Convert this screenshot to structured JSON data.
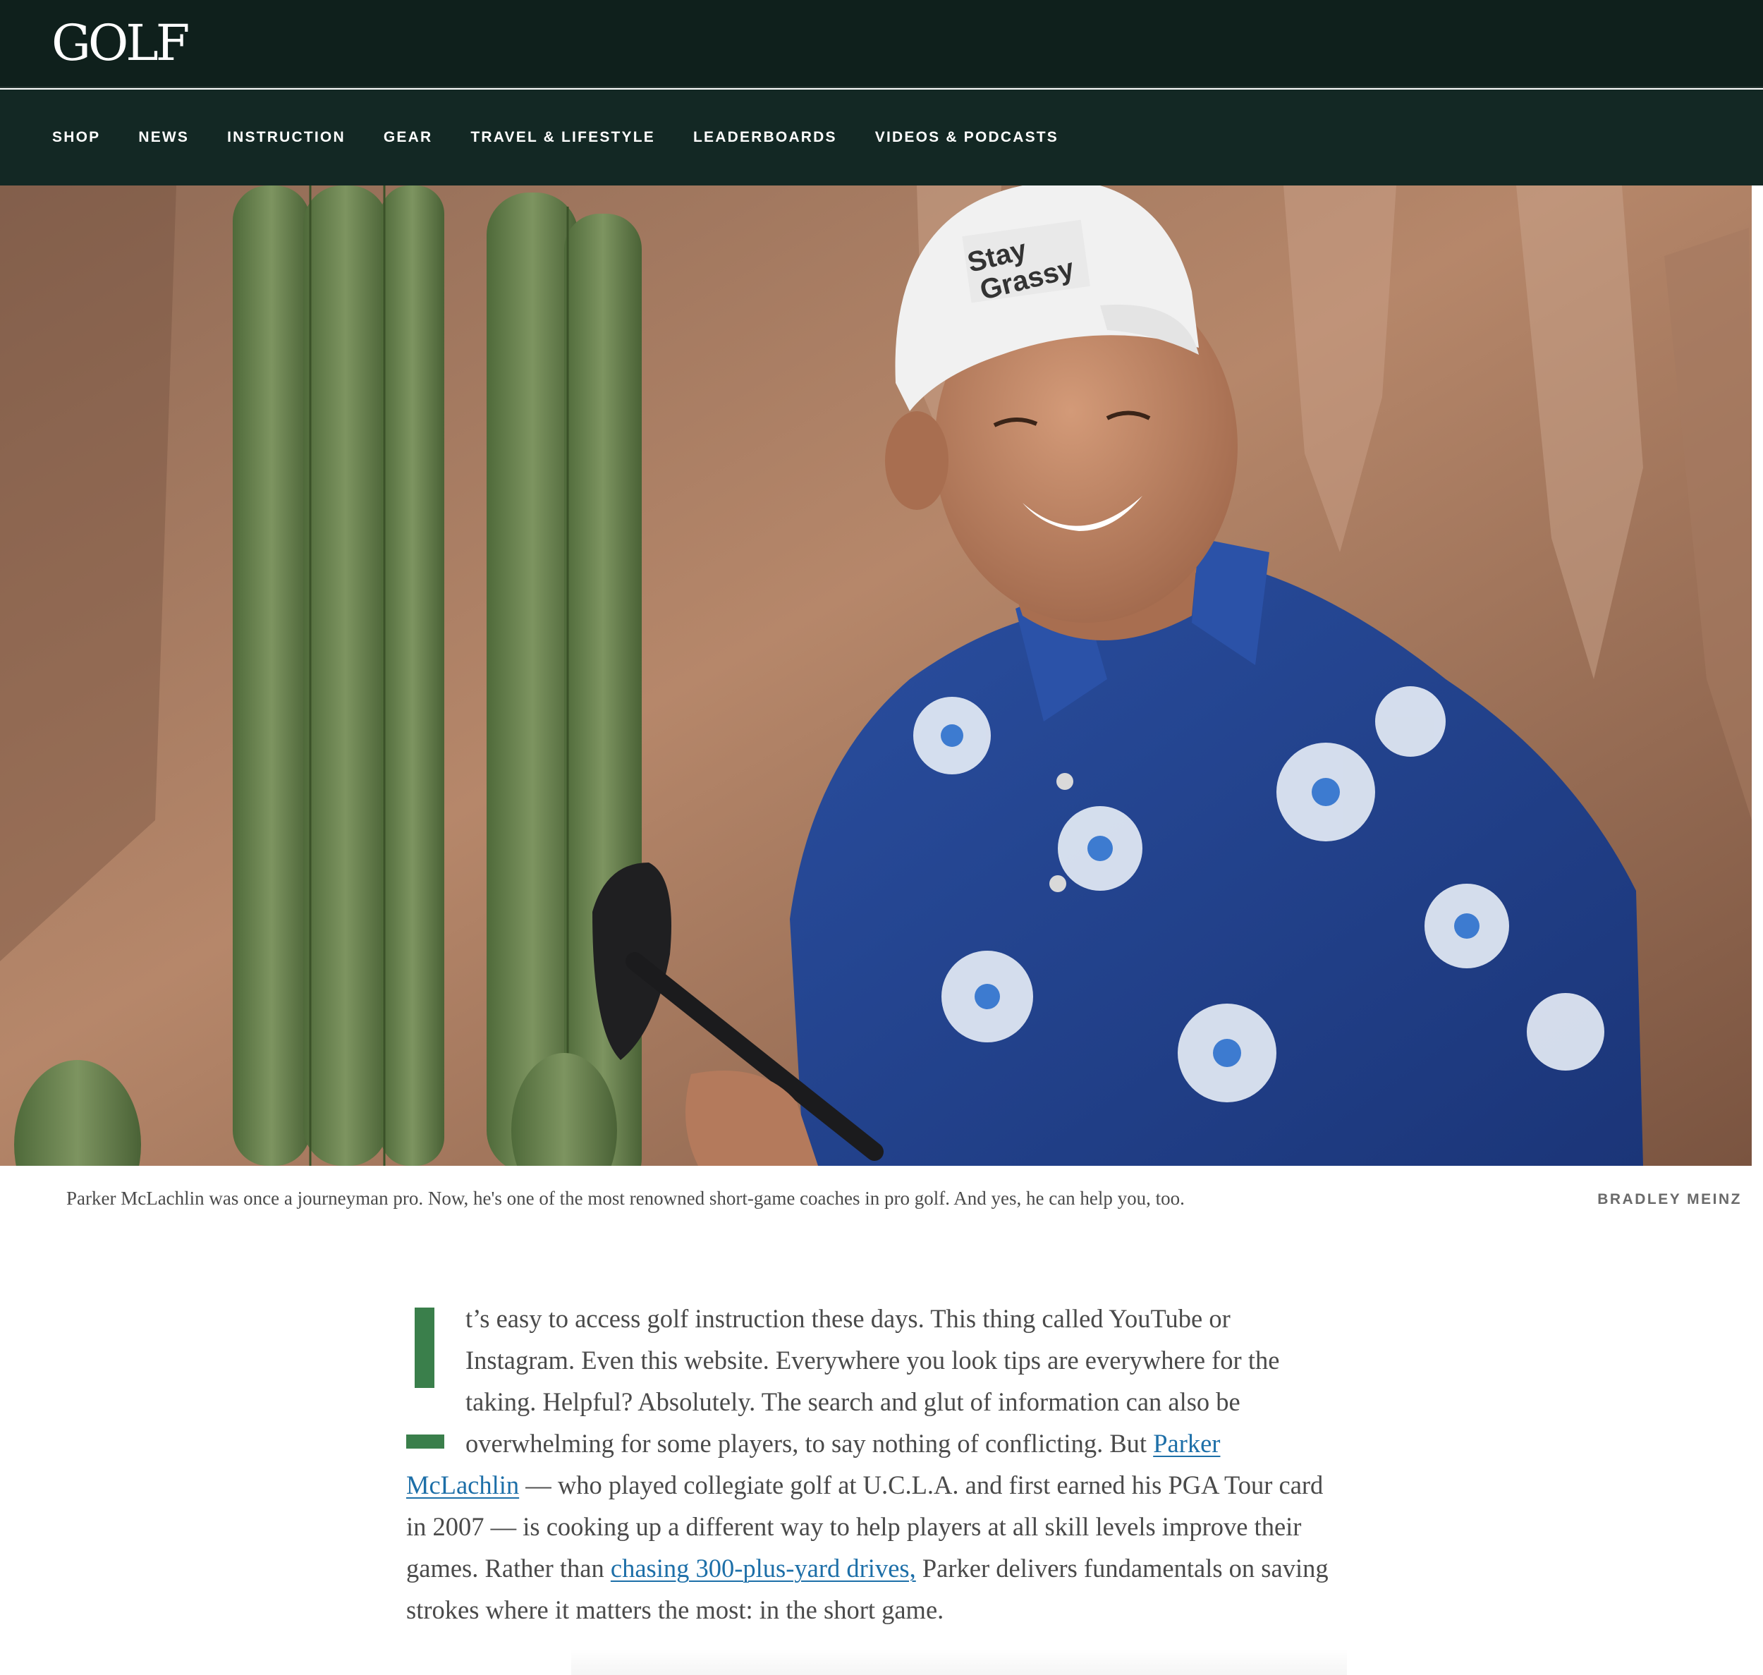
{
  "header": {
    "logo": "GOLF",
    "nav": [
      "SHOP",
      "NEWS",
      "INSTRUCTION",
      "GEAR",
      "TRAVEL & LIFESTYLE",
      "LEADERBOARDS",
      "VIDEOS & PODCASTS"
    ]
  },
  "hero": {
    "hat_text_line1": "Stay",
    "hat_text_line2": "Grassy"
  },
  "caption": {
    "text": "Parker McLachlin was once a journeyman pro. Now, he's one of the most renowned short-game coaches in pro golf. And yes, he can help you, too.",
    "credit": "BRADLEY MEINZ"
  },
  "article": {
    "dropcap": "I",
    "p1": "t’s easy to access golf instruction these days. This thing called YouTube or Instagram. Even this website. Everywhere you look tips are everywhere for the taking. Helpful? Absolutely. The search and glut of information can also be overwhelming for some players, to say nothing of conflicting. But ",
    "link1": "Parker McLachlin",
    "p2": " — who played collegiate golf at U.C.L.A. and first earned his PGA Tour card in 2007 —  is cooking up a different way to help players at all skill levels improve their games. Rather than ",
    "link2": "chasing 300-plus-yard drives,",
    "p3": " Parker delivers fundamentals on saving strokes where it matters the most: in the short game."
  },
  "colors": {
    "header_bg": "#0f201c",
    "nav_bg": "#132824",
    "accent_green": "#3a7f4b",
    "link_blue": "#1d6fa8"
  }
}
